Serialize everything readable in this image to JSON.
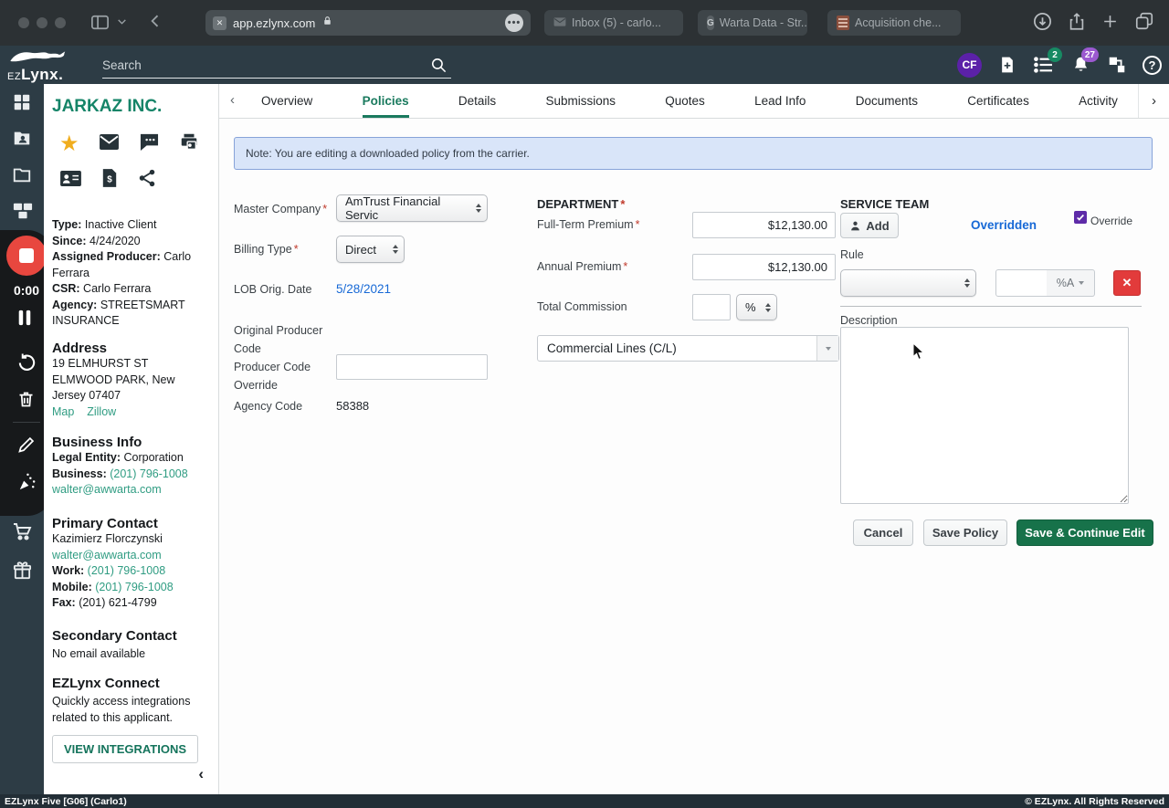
{
  "required_marker": "*",
  "browser": {
    "url": "app.ezlynx.com",
    "tabs": [
      "Inbox (5) - carlo...",
      "Warta Data - Str...",
      "Acquisition che..."
    ]
  },
  "header": {
    "logo_small": "EZ",
    "logo_big": "Lynx.",
    "search_placeholder": "Search",
    "avatar_initials": "CF",
    "list_badge": "2",
    "bell_badge": "27"
  },
  "recorder": {
    "time": "0:00"
  },
  "client": {
    "name": "JARKAZ INC.",
    "info": {
      "type_label": "Type:",
      "type": "Inactive Client",
      "since_label": "Since:",
      "since": "4/24/2020",
      "producer_label": "Assigned Producer:",
      "producer": "Carlo Ferrara",
      "csr_label": "CSR:",
      "csr": "Carlo Ferrara",
      "agency_label": "Agency:",
      "agency": "STREETSMART INSURANCE"
    },
    "address": {
      "heading": "Address",
      "line1": "19 ELMHURST ST",
      "line2": "ELMWOOD PARK, New Jersey 07407",
      "map_link": "Map",
      "zillow_link": "Zillow"
    },
    "business": {
      "heading": "Business Info",
      "legal_label": "Legal Entity:",
      "legal": "Corporation",
      "phone_label": "Business:",
      "phone": "(201) 796-1008",
      "email": "walter@awwarta.com"
    },
    "primary": {
      "heading": "Primary Contact",
      "name": "Kazimierz Florczynski",
      "email": "walter@awwarta.com",
      "work_label": "Work:",
      "work": "(201) 796-1008",
      "mobile_label": "Mobile:",
      "mobile": "(201) 796-1008",
      "fax_label": "Fax:",
      "fax": "(201) 621-4799"
    },
    "secondary": {
      "heading": "Secondary Contact",
      "note": "No email available"
    },
    "connect": {
      "heading": "EZLynx Connect",
      "description": "Quickly access integrations related to this applicant.",
      "button": "VIEW INTEGRATIONS"
    }
  },
  "tabs": [
    "Overview",
    "Policies",
    "Details",
    "Submissions",
    "Quotes",
    "Lead Info",
    "Documents",
    "Certificates",
    "Activity"
  ],
  "active_tab": "Policies",
  "form": {
    "note": "Note: You are editing a downloaded policy from the carrier.",
    "master_company_label": "Master Company",
    "master_company": "AmTrust Financial Servic",
    "billing_type_label": "Billing Type",
    "billing_type": "Direct",
    "lob_date_label": "LOB Orig. Date",
    "lob_date": "5/28/2021",
    "orig_producer_label": "Original Producer Code",
    "producer_override_label": "Producer Code Override",
    "agency_code_label": "Agency Code",
    "agency_code": "58388",
    "department": {
      "heading": "DEPARTMENT",
      "full_term_label": "Full-Term Premium",
      "full_term": "$12,130.00",
      "annual_label": "Annual Premium",
      "annual": "$12,130.00",
      "commission_label": "Total Commission",
      "commission_unit": "%",
      "lob_select": "Commercial Lines (C/L)"
    },
    "service_team": {
      "heading": "SERVICE TEAM",
      "add_button": "Add",
      "overridden": "Overridden",
      "override_label": "Override",
      "rule_label": "Rule",
      "rule_unit": "%A",
      "description_label": "Description"
    },
    "buttons": {
      "cancel": "Cancel",
      "save": "Save Policy",
      "save_continue": "Save & Continue Edit"
    }
  },
  "footer": {
    "left": "EZLynx Five [G06] (Carlo1)",
    "right": "© EZLynx. All Rights Reserved"
  },
  "colors": {
    "brand_dark": "#2d3c45",
    "accent_green": "#1a7a5e",
    "teal_link": "#2f9c82",
    "blue_link": "#1769d6",
    "purple": "#5e2ba8",
    "red": "#e23b3b"
  }
}
